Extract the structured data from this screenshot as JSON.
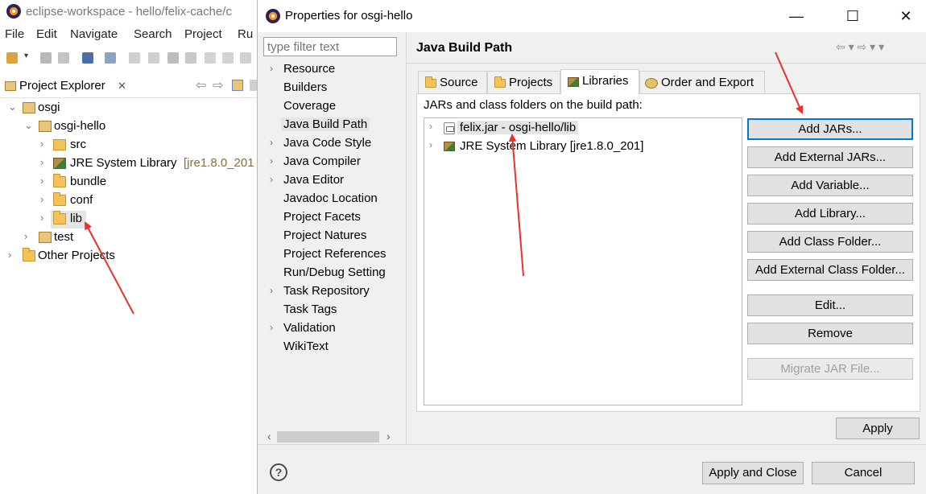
{
  "eclipse": {
    "window_title": "eclipse-workspace - hello/felix-cache/c",
    "menu": [
      "File",
      "Edit",
      "Navigate",
      "Search",
      "Project",
      "Ru"
    ],
    "explorer": {
      "tab_label": "Project Explorer",
      "tab_close": "✕",
      "tree": [
        {
          "label": "osgi",
          "chevron": "⌄",
          "icon": "project-icon"
        },
        {
          "label": "osgi-hello",
          "chevron": "⌄",
          "icon": "project-icon"
        },
        {
          "label": "src",
          "chevron": "›",
          "icon": "package-folder-icon"
        },
        {
          "label": "JRE System Library",
          "suffix": "[jre1.8.0_201",
          "chevron": "›",
          "icon": "library-icon"
        },
        {
          "label": "bundle",
          "chevron": "›",
          "icon": "folder-icon"
        },
        {
          "label": "conf",
          "chevron": "›",
          "icon": "folder-icon"
        },
        {
          "label": "lib",
          "chevron": "›",
          "icon": "folder-icon"
        },
        {
          "label": "test",
          "chevron": "›",
          "icon": "project-icon"
        },
        {
          "label": "Other Projects",
          "chevron": "›",
          "icon": "folder-icon"
        }
      ]
    }
  },
  "dialog": {
    "title": "Properties for osgi-hello",
    "minimize": "—",
    "maximize": "☐",
    "close": "✕",
    "filter_placeholder": "type filter text",
    "nav_items": [
      {
        "label": "Resource",
        "chevron": "›"
      },
      {
        "label": "Builders",
        "chevron": ""
      },
      {
        "label": "Coverage",
        "chevron": ""
      },
      {
        "label": "Java Build Path",
        "chevron": "",
        "selected": true
      },
      {
        "label": "Java Code Style",
        "chevron": "›"
      },
      {
        "label": "Java Compiler",
        "chevron": "›"
      },
      {
        "label": "Java Editor",
        "chevron": "›"
      },
      {
        "label": "Javadoc Location",
        "chevron": ""
      },
      {
        "label": "Project Facets",
        "chevron": ""
      },
      {
        "label": "Project Natures",
        "chevron": ""
      },
      {
        "label": "Project References",
        "chevron": ""
      },
      {
        "label": "Run/Debug Setting",
        "chevron": ""
      },
      {
        "label": "Task Repository",
        "chevron": "›"
      },
      {
        "label": "Task Tags",
        "chevron": ""
      },
      {
        "label": "Validation",
        "chevron": "›"
      },
      {
        "label": "WikiText",
        "chevron": ""
      }
    ],
    "scroll_left": "‹",
    "scroll_right": "›",
    "page_title": "Java Build Path",
    "page_nav": "⇦ ▾ ⇨ ▾ ▾",
    "tabs": [
      {
        "label": "Source",
        "icon": "source-folder-icon"
      },
      {
        "label": "Projects",
        "icon": "projects-icon"
      },
      {
        "label": "Libraries",
        "icon": "libraries-icon",
        "active": true
      },
      {
        "label": "Order and Export",
        "icon": "order-export-icon"
      }
    ],
    "libraries": {
      "caption": "JARs and class folders on the build path:",
      "entries": [
        {
          "label": "felix.jar - osgi-hello/lib",
          "chevron": "›",
          "icon": "jar-icon"
        },
        {
          "label": "JRE System Library [jre1.8.0_201]",
          "chevron": "›",
          "icon": "library-icon"
        }
      ],
      "buttons": {
        "add_jars": "Add JARs...",
        "add_external_jars": "Add External JARs...",
        "add_variable": "Add Variable...",
        "add_library": "Add Library...",
        "add_class_folder": "Add Class Folder...",
        "add_external_class_folder": "Add External Class Folder...",
        "edit": "Edit...",
        "remove": "Remove",
        "migrate_jar": "Migrate JAR File..."
      }
    },
    "apply": "Apply",
    "help": "?",
    "apply_and_close": "Apply and Close",
    "cancel": "Cancel"
  },
  "colors": {
    "annotation_arrow": "#e8312a",
    "default_button_border": "#0078d7",
    "selection": "#e5e5e5"
  }
}
